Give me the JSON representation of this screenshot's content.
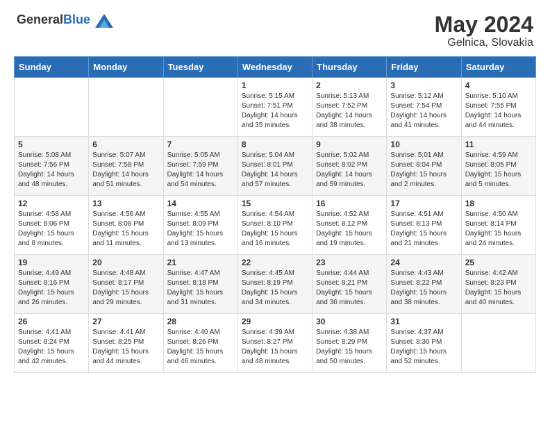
{
  "header": {
    "logo_general": "General",
    "logo_blue": "Blue",
    "month_year": "May 2024",
    "location": "Gelnica, Slovakia"
  },
  "calendar": {
    "days_of_week": [
      "Sunday",
      "Monday",
      "Tuesday",
      "Wednesday",
      "Thursday",
      "Friday",
      "Saturday"
    ],
    "weeks": [
      [
        {
          "day": "",
          "info": ""
        },
        {
          "day": "",
          "info": ""
        },
        {
          "day": "",
          "info": ""
        },
        {
          "day": "1",
          "info": "Sunrise: 5:15 AM\nSunset: 7:51 PM\nDaylight: 14 hours\nand 35 minutes."
        },
        {
          "day": "2",
          "info": "Sunrise: 5:13 AM\nSunset: 7:52 PM\nDaylight: 14 hours\nand 38 minutes."
        },
        {
          "day": "3",
          "info": "Sunrise: 5:12 AM\nSunset: 7:54 PM\nDaylight: 14 hours\nand 41 minutes."
        },
        {
          "day": "4",
          "info": "Sunrise: 5:10 AM\nSunset: 7:55 PM\nDaylight: 14 hours\nand 44 minutes."
        }
      ],
      [
        {
          "day": "5",
          "info": "Sunrise: 5:08 AM\nSunset: 7:56 PM\nDaylight: 14 hours\nand 48 minutes."
        },
        {
          "day": "6",
          "info": "Sunrise: 5:07 AM\nSunset: 7:58 PM\nDaylight: 14 hours\nand 51 minutes."
        },
        {
          "day": "7",
          "info": "Sunrise: 5:05 AM\nSunset: 7:59 PM\nDaylight: 14 hours\nand 54 minutes."
        },
        {
          "day": "8",
          "info": "Sunrise: 5:04 AM\nSunset: 8:01 PM\nDaylight: 14 hours\nand 57 minutes."
        },
        {
          "day": "9",
          "info": "Sunrise: 5:02 AM\nSunset: 8:02 PM\nDaylight: 14 hours\nand 59 minutes."
        },
        {
          "day": "10",
          "info": "Sunrise: 5:01 AM\nSunset: 8:04 PM\nDaylight: 15 hours\nand 2 minutes."
        },
        {
          "day": "11",
          "info": "Sunrise: 4:59 AM\nSunset: 8:05 PM\nDaylight: 15 hours\nand 5 minutes."
        }
      ],
      [
        {
          "day": "12",
          "info": "Sunrise: 4:58 AM\nSunset: 8:06 PM\nDaylight: 15 hours\nand 8 minutes."
        },
        {
          "day": "13",
          "info": "Sunrise: 4:56 AM\nSunset: 8:08 PM\nDaylight: 15 hours\nand 11 minutes."
        },
        {
          "day": "14",
          "info": "Sunrise: 4:55 AM\nSunset: 8:09 PM\nDaylight: 15 hours\nand 13 minutes."
        },
        {
          "day": "15",
          "info": "Sunrise: 4:54 AM\nSunset: 8:10 PM\nDaylight: 15 hours\nand 16 minutes."
        },
        {
          "day": "16",
          "info": "Sunrise: 4:52 AM\nSunset: 8:12 PM\nDaylight: 15 hours\nand 19 minutes."
        },
        {
          "day": "17",
          "info": "Sunrise: 4:51 AM\nSunset: 8:13 PM\nDaylight: 15 hours\nand 21 minutes."
        },
        {
          "day": "18",
          "info": "Sunrise: 4:50 AM\nSunset: 8:14 PM\nDaylight: 15 hours\nand 24 minutes."
        }
      ],
      [
        {
          "day": "19",
          "info": "Sunrise: 4:49 AM\nSunset: 8:16 PM\nDaylight: 15 hours\nand 26 minutes."
        },
        {
          "day": "20",
          "info": "Sunrise: 4:48 AM\nSunset: 8:17 PM\nDaylight: 15 hours\nand 29 minutes."
        },
        {
          "day": "21",
          "info": "Sunrise: 4:47 AM\nSunset: 8:18 PM\nDaylight: 15 hours\nand 31 minutes."
        },
        {
          "day": "22",
          "info": "Sunrise: 4:45 AM\nSunset: 8:19 PM\nDaylight: 15 hours\nand 34 minutes."
        },
        {
          "day": "23",
          "info": "Sunrise: 4:44 AM\nSunset: 8:21 PM\nDaylight: 15 hours\nand 36 minutes."
        },
        {
          "day": "24",
          "info": "Sunrise: 4:43 AM\nSunset: 8:22 PM\nDaylight: 15 hours\nand 38 minutes."
        },
        {
          "day": "25",
          "info": "Sunrise: 4:42 AM\nSunset: 8:23 PM\nDaylight: 15 hours\nand 40 minutes."
        }
      ],
      [
        {
          "day": "26",
          "info": "Sunrise: 4:41 AM\nSunset: 8:24 PM\nDaylight: 15 hours\nand 42 minutes."
        },
        {
          "day": "27",
          "info": "Sunrise: 4:41 AM\nSunset: 8:25 PM\nDaylight: 15 hours\nand 44 minutes."
        },
        {
          "day": "28",
          "info": "Sunrise: 4:40 AM\nSunset: 8:26 PM\nDaylight: 15 hours\nand 46 minutes."
        },
        {
          "day": "29",
          "info": "Sunrise: 4:39 AM\nSunset: 8:27 PM\nDaylight: 15 hours\nand 48 minutes."
        },
        {
          "day": "30",
          "info": "Sunrise: 4:38 AM\nSunset: 8:29 PM\nDaylight: 15 hours\nand 50 minutes."
        },
        {
          "day": "31",
          "info": "Sunrise: 4:37 AM\nSunset: 8:30 PM\nDaylight: 15 hours\nand 52 minutes."
        },
        {
          "day": "",
          "info": ""
        }
      ]
    ]
  }
}
